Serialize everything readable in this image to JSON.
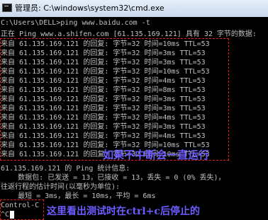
{
  "window": {
    "title": "管理员: C:\\windows\\system32\\cmd.exe"
  },
  "console": {
    "prompt": "C:\\Users\\DELL>ping www.baidu.com -t",
    "blank": "",
    "header": "正在 Ping www.a.shifen.com [61.135.169.121] 具有 32 字节的数据:",
    "replies": [
      "来自 61.135.169.121 的回复: 字节=32 时间=10ms TTL=53",
      "来自 61.135.169.121 的回复: 字节=32 时间=3ms TTL=53",
      "来自 61.135.169.121 的回复: 字节=32 时间=3ms TTL=53",
      "来自 61.135.169.121 的回复: 字节=32 时间=10ms TTL=53",
      "来自 61.135.169.121 的回复: 字节=32 时间=4ms TTL=53",
      "来自 61.135.169.121 的回复: 字节=32 时间=8ms TTL=53",
      "来自 61.135.169.121 的回复: 字节=32 时间=3ms TTL=53",
      "来自 61.135.169.121 的回复: 字节=32 时间=3ms TTL=53",
      "来自 61.135.169.121 的回复: 字节=32 时间=4ms TTL=53",
      "来自 61.135.169.121 的回复: 字节=32 时间=3ms TTL=53",
      "来自 61.135.169.121 的回复: 字节=32 时间=4ms TTL=53",
      "来自 61.135.169.121 的回复: 字节=32 时间=10ms TTL=53",
      "来自 61.135.169.121 的回复: 字节=32 时间=10ms TTL=53"
    ],
    "stats_header": "61.135.169.121 的 Ping 统计信息:",
    "stats_packets": "    数据包: 已发送 = 13，已接收 = 13，丢失 = 0 (0% 丢失)，",
    "stats_rtt_header": "往返行程的估计时间(以毫秒为单位):",
    "stats_rtt": "    最短 = 3ms，最长 = 10ms，平均 = 6ms",
    "ctrl_c": "Control-C",
    "caret_c": "^C"
  },
  "annotations": {
    "continuous": "如果不中断会一直运行",
    "stopped": "这里看出测试时在ctrl+c后停止的"
  },
  "colors": {
    "box": "#e02020",
    "annotation": "#6d5cff",
    "console_text": "#c0c0c0"
  }
}
